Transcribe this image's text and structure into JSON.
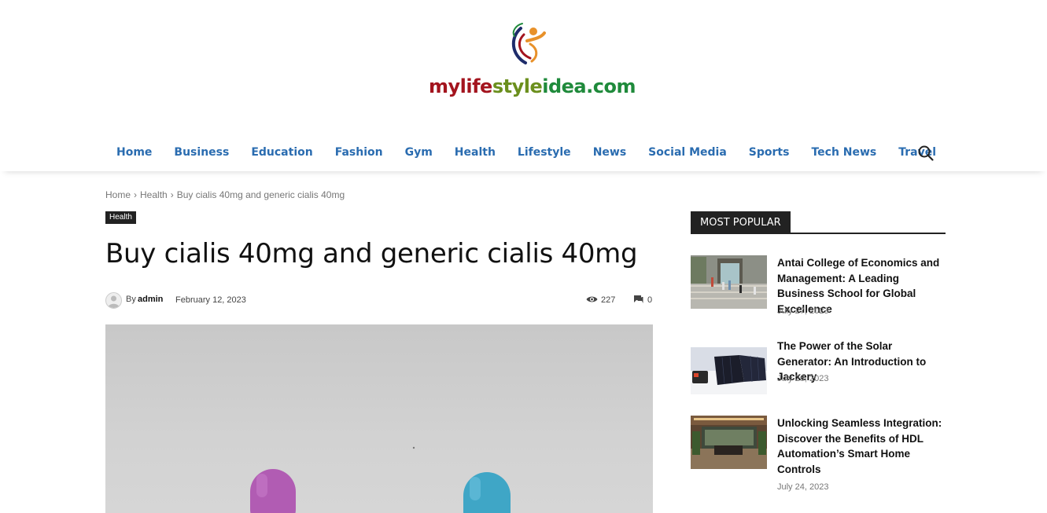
{
  "site": {
    "logo_text": "mylifestyleidea.com",
    "logo_part1": "mylife",
    "logo_part2": "style",
    "logo_part3": "idea.com"
  },
  "nav": {
    "items": [
      {
        "label": "Home"
      },
      {
        "label": "Business"
      },
      {
        "label": "Education"
      },
      {
        "label": "Fashion"
      },
      {
        "label": "Gym"
      },
      {
        "label": "Health"
      },
      {
        "label": "Lifestyle"
      },
      {
        "label": "News"
      },
      {
        "label": "Social Media"
      },
      {
        "label": "Sports"
      },
      {
        "label": "Tech News"
      },
      {
        "label": "Travel"
      }
    ],
    "search_icon": "search-icon",
    "color": "#2a6cb0"
  },
  "breadcrumb": {
    "home": "Home",
    "category": "Health",
    "current": "Buy cialis 40mg and generic cialis 40mg"
  },
  "post": {
    "category": "Health",
    "title": "Buy cialis 40mg and generic cialis 40mg",
    "by": "By",
    "author": "admin",
    "date": "February 12, 2023",
    "views": "227",
    "comments": "0"
  },
  "sidebar": {
    "heading": "MOST POPULAR",
    "items": [
      {
        "title": "Antai College of Economics and Management: A Leading Business School for Global Excellence",
        "date": "July 27, 2023"
      },
      {
        "title": "The Power of the Solar Generator: An Introduction to Jackery",
        "date": "July 26, 2023"
      },
      {
        "title": "Unlocking Seamless Integration: Discover the Benefits of HDL Automation’s Smart Home Controls",
        "date": "July 24, 2023"
      }
    ]
  }
}
